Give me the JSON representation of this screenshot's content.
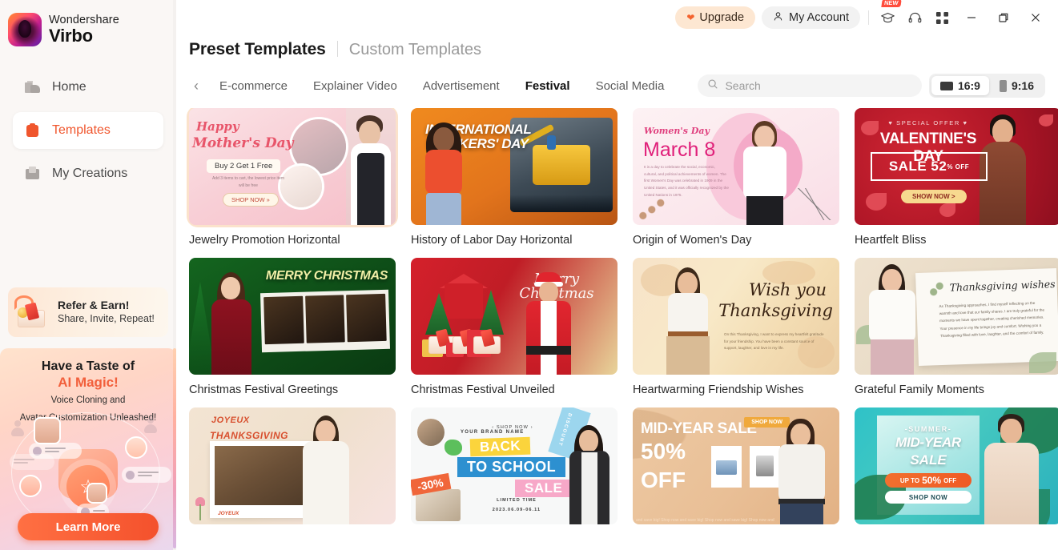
{
  "brand": {
    "top": "Wondershare",
    "bottom": "Virbo",
    "logo_icon": "virbo-avatar-logo"
  },
  "sidebar": {
    "items": [
      {
        "label": "Home",
        "icon": "home-icon",
        "active": false
      },
      {
        "label": "Templates",
        "icon": "templates-icon",
        "active": true
      },
      {
        "label": "My Creations",
        "icon": "my-creations-icon",
        "active": false
      }
    ],
    "refer": {
      "title": "Refer & Earn!",
      "subtitle": "Share, Invite, Repeat!",
      "icon": "gift-box-icon"
    },
    "promo": {
      "line1": "Have a Taste of",
      "line2": "AI Magic!",
      "line3": "Voice Cloning and",
      "line4": "Avatar Customization Unleashed!",
      "button": "Learn More"
    }
  },
  "topbar": {
    "upgrade": "Upgrade",
    "account": "My Account",
    "new_badge": "NEW",
    "icons": [
      {
        "name": "graduation-cap-icon",
        "badge": "NEW"
      },
      {
        "name": "headset-support-icon"
      },
      {
        "name": "grid-apps-icon"
      }
    ],
    "window": [
      {
        "name": "minimize-button"
      },
      {
        "name": "maximize-button"
      },
      {
        "name": "close-button"
      }
    ]
  },
  "header": {
    "preset": "Preset Templates",
    "custom": "Custom Templates"
  },
  "tabs": {
    "prev_label": "‹",
    "items": [
      {
        "label": "E-commerce",
        "active": false
      },
      {
        "label": "Explainer Video",
        "active": false
      },
      {
        "label": "Advertisement",
        "active": false
      },
      {
        "label": "Festival",
        "active": true
      },
      {
        "label": "Social Media",
        "active": false
      }
    ]
  },
  "search": {
    "placeholder": "Search",
    "value": "",
    "icon": "search-icon"
  },
  "ratio": {
    "landscape": {
      "label": "16:9",
      "active": true,
      "icon": "landscape-icon"
    },
    "portrait": {
      "label": "9:16",
      "active": false,
      "icon": "portrait-icon"
    }
  },
  "templates": {
    "rows": [
      [
        {
          "title": "Jewelry Promotion Horizontal",
          "selected": true,
          "art": {
            "t1": "Happy",
            "t2": "Mother's Day",
            "pill": "Buy 2 Get 1 Free",
            "fine": "Add 3 items to cart, the lowest price item will be free",
            "shop": "SHOP NOW »"
          }
        },
        {
          "title": "History of Labor Day Horizontal",
          "selected": false,
          "art": {
            "t1": "INTERNATIONAL WORKERS' DAY"
          }
        },
        {
          "title": "Origin of Women's Day",
          "selected": false,
          "art": {
            "t1": "Women's Day",
            "t2": "March 8",
            "fine": "It is a day to celebrate the social, economic, cultural, and political achievements of women. The first Women's Day was celebrated in 1909 in the United States, and it was officially recognized by the United Nations in 1975."
          }
        },
        {
          "title": "Heartfelt Bliss",
          "selected": false,
          "art": {
            "so": "♥ SPECIAL OFFER ♥",
            "t1": "VALENTINE'S DAY",
            "sale": "SALE 52",
            "off": "% OFF",
            "btn": "SHOW NOW >"
          }
        }
      ],
      [
        {
          "title": "Christmas Festival Greetings",
          "selected": false,
          "art": {
            "t1": "MERRY CHRISTMAS"
          }
        },
        {
          "title": "Christmas Festival Unveiled",
          "selected": false,
          "art": {
            "t1": "Merry Christmas"
          }
        },
        {
          "title": "Heartwarming Friendship Wishes",
          "selected": false,
          "art": {
            "t1": "Wish you",
            "t2": "Thanksgiving",
            "fine": "On this Thanksgiving, I want to express my heartfelt gratitude for your friendship. You have been a constant source of support, laughter, and love in my life."
          }
        },
        {
          "title": "Grateful Family Moments",
          "selected": false,
          "art": {
            "t1": "Thanksgiving wishes",
            "fine": "As Thanksgiving approaches, I find myself reflecting on the warmth and love that our family shares. I am truly grateful for the moments we have spent together, creating cherished memories. Your presence in my life brings joy and comfort. Wishing you a Thanksgiving filled with love, laughter, and the comfort of family."
          }
        }
      ],
      [
        {
          "title": "",
          "selected": false,
          "art": {
            "t1": "JOYEUX",
            "t2": "THANKSGIVING",
            "cap": "JOYEUX"
          }
        },
        {
          "title": "",
          "selected": false,
          "art": {
            "brand": "YOUR BRAND NAME",
            "shop": "‹ SHOP NOW ›",
            "b1": "BACK",
            "b2": "TO SCHOOL",
            "b3": "SALE",
            "disc": "DISCOUNT",
            "p30": "-30%",
            "lt1": "LIMITED TIME",
            "lt2": "2023.06.09-06.11"
          }
        },
        {
          "title": "",
          "selected": false,
          "art": {
            "t1": "MID-YEAR SALE",
            "t2": "50%",
            "t3": "OFF",
            "sn": "SHOP NOW",
            "tick": "and save big!   Shop now and save big!   Shop now and save big!   Shop now and"
          }
        },
        {
          "title": "",
          "selected": false,
          "art": {
            "s1": "-SUMMER-",
            "s2": "MID-YEAR",
            "s3": "SALE",
            "bar1a": "UP TO",
            "bar1b": "50%",
            "bar1c": "OFF",
            "bar2": "SHOP NOW"
          }
        }
      ]
    ]
  },
  "colors": {
    "accent": "#f0562d",
    "sidebar_bg": "#faf7f5",
    "upgrade_bg": "#fde7d2",
    "selection_ring": "#fbe2cb"
  }
}
